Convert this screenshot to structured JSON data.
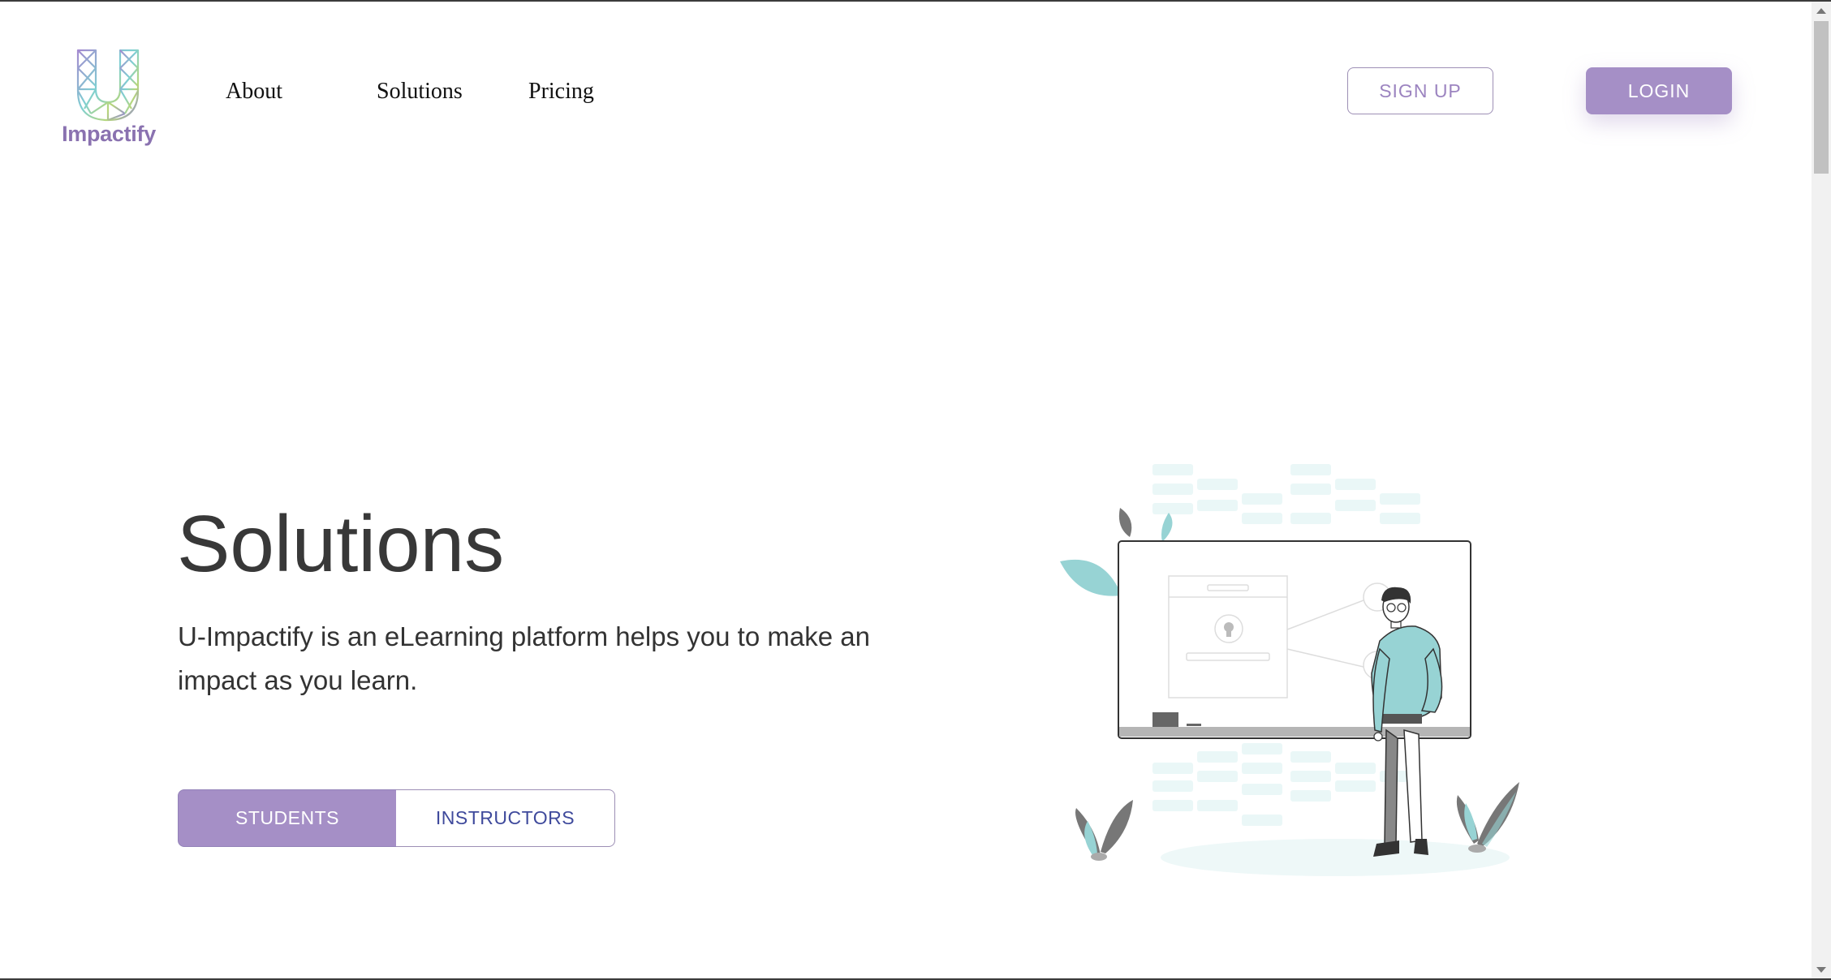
{
  "header": {
    "logo_text": "Impactify",
    "nav": [
      "About",
      "Solutions",
      "Pricing"
    ],
    "signup_label": "SIGN UP",
    "login_label": "LOGIN"
  },
  "hero": {
    "title": "Solutions",
    "description": "U-Impactify is an eLearning platform helps you to make an impact as you learn.",
    "tabs": [
      "STUDENTS",
      "INSTRUCTORS"
    ],
    "active_tab": "STUDENTS"
  },
  "colors": {
    "accent": "#a58fc6",
    "teal": "#97d3d4",
    "text": "#383838",
    "instructors_text": "#3f4a9c"
  }
}
